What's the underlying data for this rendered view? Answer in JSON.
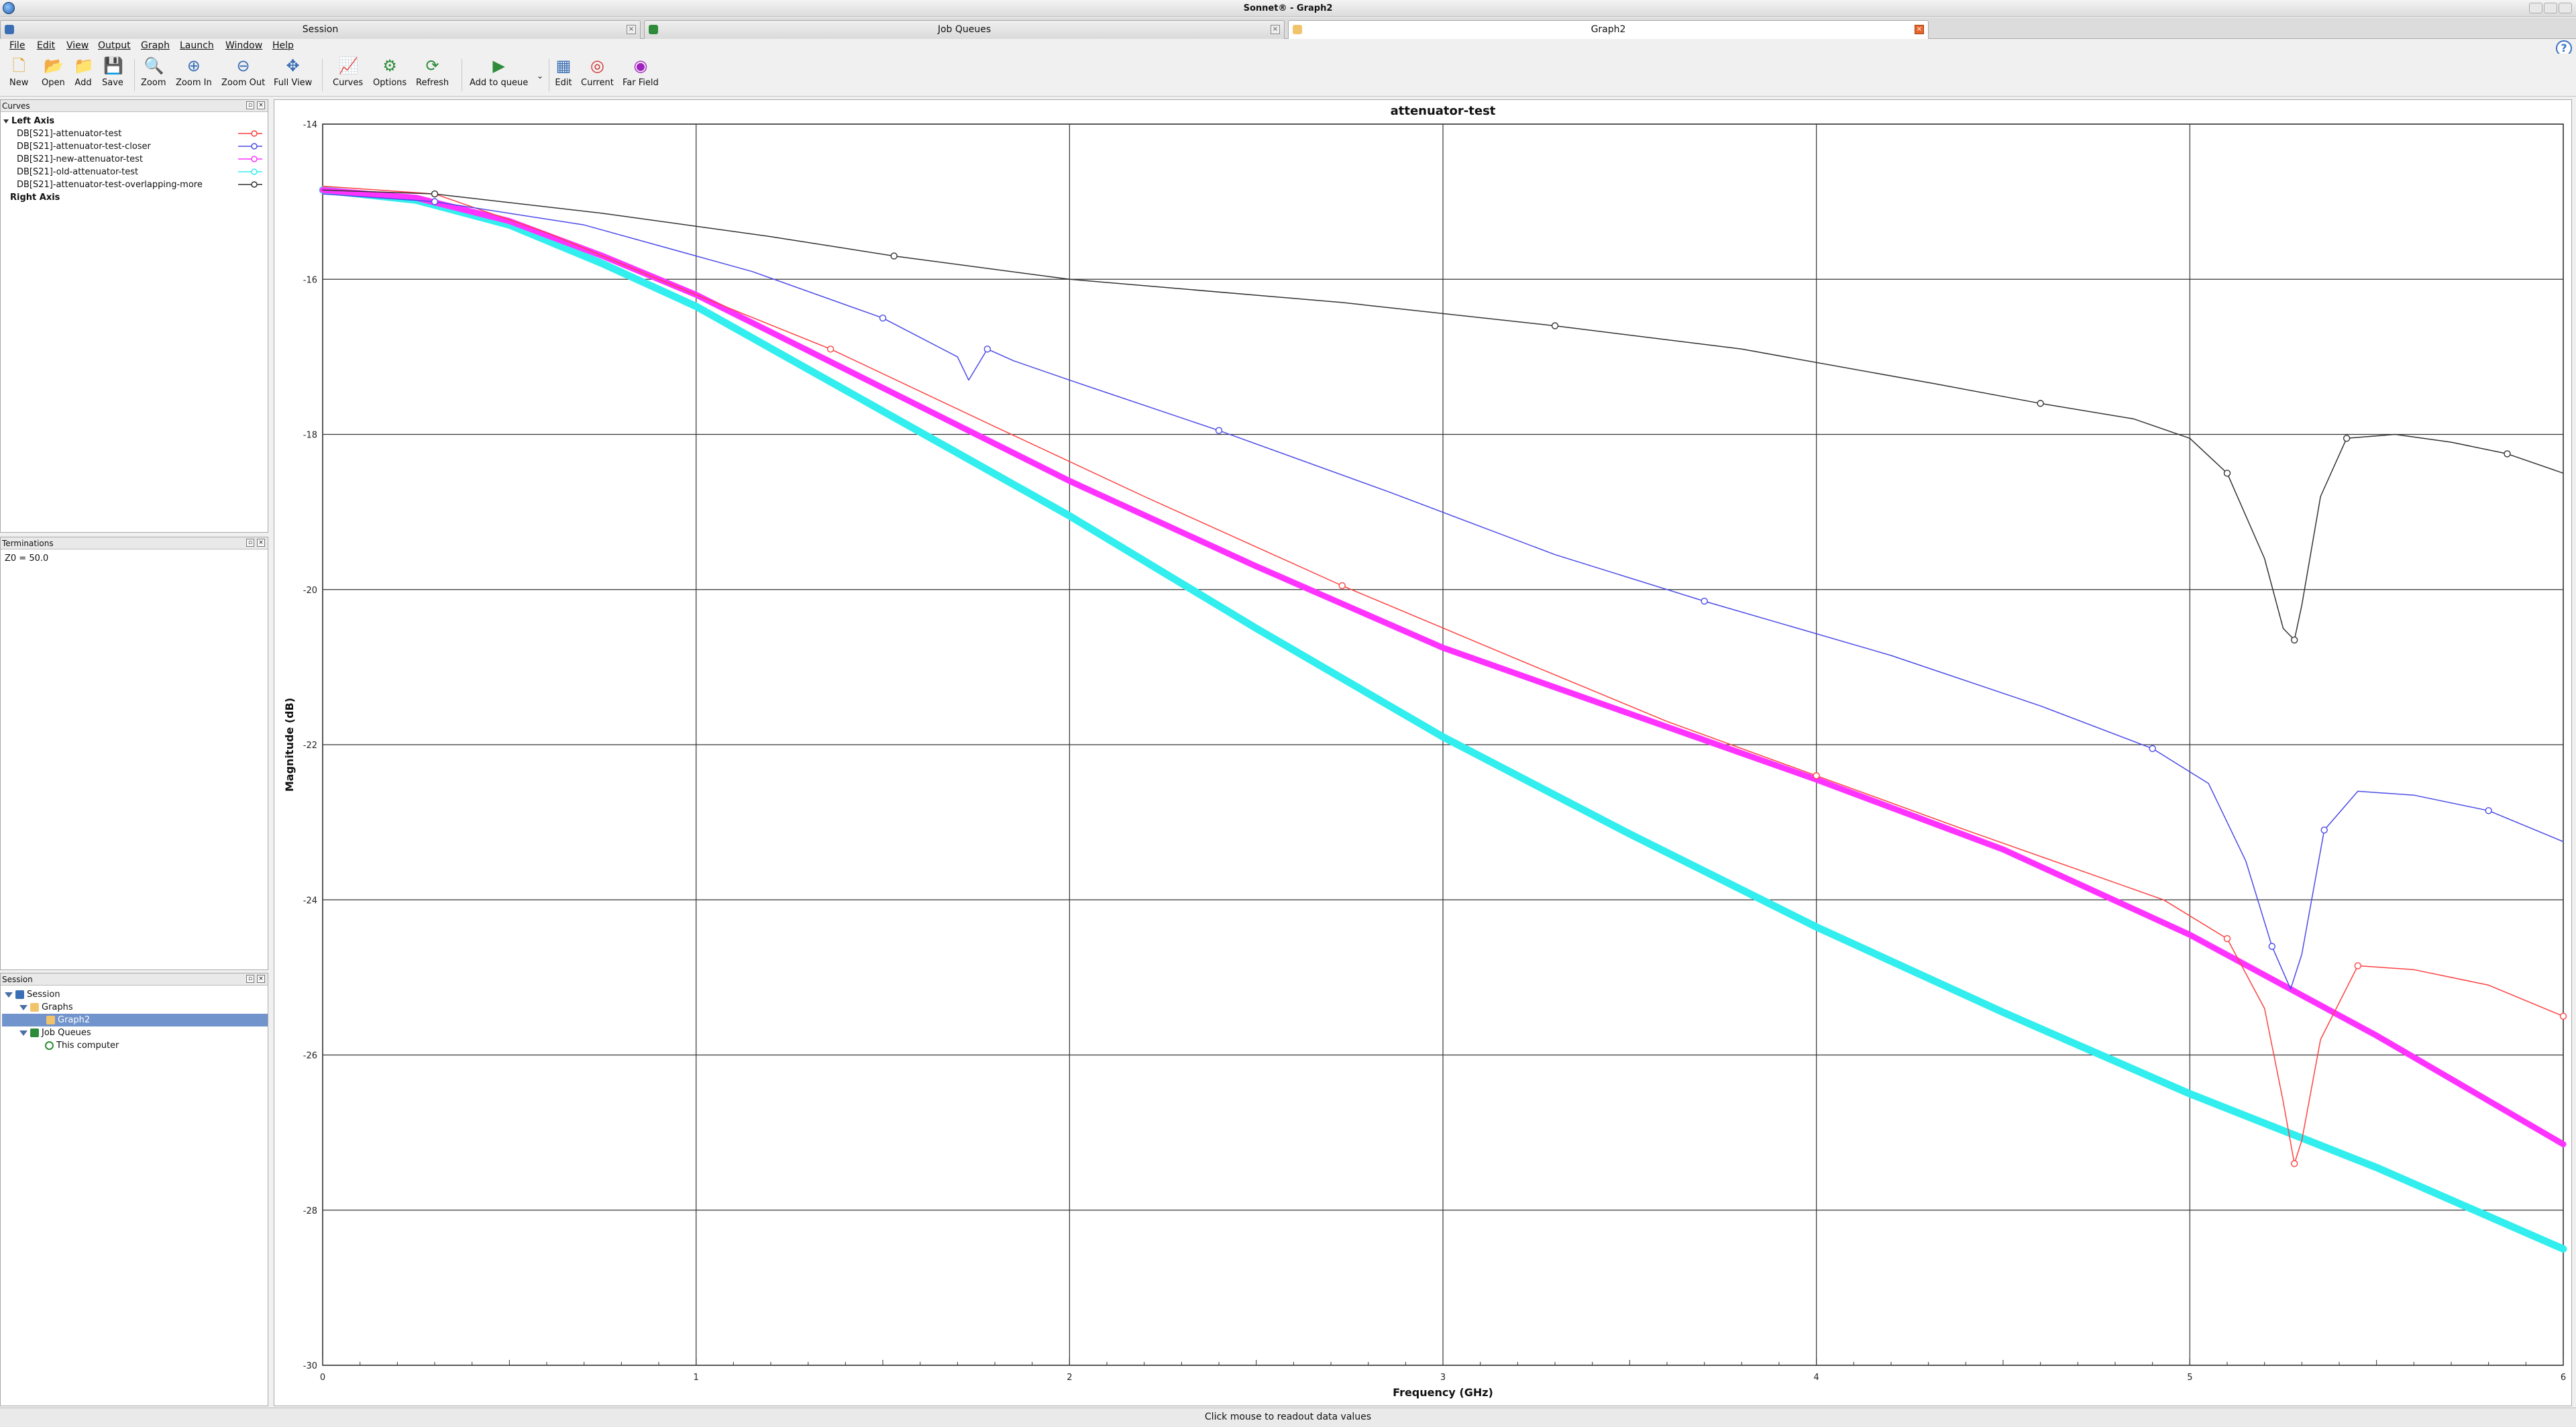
{
  "window": {
    "title": "Sonnet® - Graph2"
  },
  "tabs": [
    {
      "label": "Session"
    },
    {
      "label": "Job Queues"
    },
    {
      "label": "Graph2",
      "active": true
    }
  ],
  "menu": [
    "File",
    "Edit",
    "View",
    "Output",
    "Graph",
    "Launch",
    "Window",
    "Help"
  ],
  "toolbar": [
    {
      "label": "New",
      "icon": "new-file-icon"
    },
    {
      "label": "Open",
      "icon": "folder-open-icon"
    },
    {
      "label": "Add",
      "icon": "add-folder-icon"
    },
    {
      "label": "Save",
      "icon": "save-icon"
    },
    {
      "label": "Zoom",
      "icon": "magnifier-icon"
    },
    {
      "label": "Zoom In",
      "icon": "zoom-in-icon"
    },
    {
      "label": "Zoom Out",
      "icon": "zoom-out-icon"
    },
    {
      "label": "Full View",
      "icon": "full-view-icon"
    },
    {
      "label": "Curves",
      "icon": "curves-icon"
    },
    {
      "label": "Options",
      "icon": "gear-icon"
    },
    {
      "label": "Refresh",
      "icon": "refresh-icon"
    },
    {
      "label": "Add to queue",
      "icon": "add-to-queue-icon"
    },
    {
      "label": "Edit",
      "icon": "edit-icon"
    },
    {
      "label": "Current",
      "icon": "current-icon"
    },
    {
      "label": "Far Field",
      "icon": "far-field-icon"
    }
  ],
  "curves_panel": {
    "title": "Curves",
    "left_axis_label": "Left Axis",
    "right_axis_label": "Right Axis",
    "curves": [
      {
        "label": "DB[S21]-attenuator-test",
        "color": "#ff4040"
      },
      {
        "label": "DB[S21]-attenuator-test-closer",
        "color": "#4a4ae8"
      },
      {
        "label": "DB[S21]-new-attenuator-test",
        "color": "#ff33ff"
      },
      {
        "label": "DB[S21]-old-attenuator-test",
        "color": "#33eeee"
      },
      {
        "label": "DB[S21]-attenuator-test-overlapping-more",
        "color": "#333333"
      }
    ]
  },
  "terminations_panel": {
    "title": "Terminations",
    "text": "Z0 = 50.0"
  },
  "session_panel": {
    "title": "Session",
    "items": [
      {
        "label": "Session",
        "level": 0
      },
      {
        "label": "Graphs",
        "level": 1
      },
      {
        "label": "Graph2",
        "level": 2,
        "selected": true
      },
      {
        "label": "Job Queues",
        "level": 1
      },
      {
        "label": "This computer",
        "level": 2
      }
    ]
  },
  "status": {
    "text": "Click mouse to readout data values"
  },
  "chart_data": {
    "type": "line",
    "title": "attenuator-test",
    "xlabel": "Frequency (GHz)",
    "ylabel": "Magnitude (dB)",
    "xlim": [
      0,
      6
    ],
    "ylim": [
      -30,
      -14
    ],
    "xticks": [
      0,
      1,
      2,
      3,
      4,
      5,
      6
    ],
    "yticks": [
      -30,
      -28,
      -26,
      -24,
      -22,
      -20,
      -18,
      -16,
      -14
    ],
    "grid": true,
    "series": [
      {
        "name": "DB[S21]-attenuator-test",
        "color": "#ff4040",
        "width": 1.5,
        "x": [
          0,
          0.3,
          0.6,
          1.0,
          1.36,
          1.8,
          2.2,
          2.73,
          3.2,
          3.6,
          4.0,
          4.4,
          4.93,
          5.1,
          5.2,
          5.25,
          5.28,
          5.3,
          5.35,
          5.45,
          5.6,
          5.8,
          6.0
        ],
        "y": [
          -14.8,
          -14.9,
          -15.4,
          -16.2,
          -16.9,
          -17.9,
          -18.8,
          -19.95,
          -20.9,
          -21.7,
          -22.4,
          -23.1,
          -24.0,
          -24.5,
          -25.4,
          -26.6,
          -27.4,
          -27.1,
          -25.8,
          -24.85,
          -24.9,
          -25.1,
          -25.5
        ]
      },
      {
        "name": "DB[S21]-attenuator-test-closer",
        "color": "#4a4ae8",
        "width": 1.5,
        "x": [
          0,
          0.3,
          0.7,
          1.15,
          1.5,
          1.7,
          1.73,
          1.78,
          1.85,
          2.0,
          2.4,
          2.86,
          3.3,
          3.7,
          4.2,
          4.6,
          4.9,
          5.05,
          5.15,
          5.22,
          5.27,
          5.3,
          5.36,
          5.45,
          5.6,
          5.8,
          6.0
        ],
        "y": [
          -14.9,
          -15.0,
          -15.3,
          -15.9,
          -16.5,
          -17.0,
          -17.3,
          -16.9,
          -17.05,
          -17.3,
          -17.95,
          -18.75,
          -19.55,
          -20.15,
          -20.85,
          -21.5,
          -22.05,
          -22.5,
          -23.5,
          -24.6,
          -25.15,
          -24.7,
          -23.1,
          -22.6,
          -22.65,
          -22.85,
          -23.25
        ]
      },
      {
        "name": "DB[S21]-new-attenuator-test",
        "color": "#ff33ff",
        "width": 9,
        "x": [
          0,
          0.25,
          0.5,
          0.75,
          1.0,
          1.5,
          2.0,
          2.5,
          3.0,
          3.5,
          4.0,
          4.5,
          5.0,
          5.5,
          6.0
        ],
        "y": [
          -14.85,
          -14.95,
          -15.25,
          -15.7,
          -16.2,
          -17.4,
          -18.6,
          -19.7,
          -20.75,
          -21.6,
          -22.45,
          -23.35,
          -24.45,
          -25.75,
          -27.15
        ]
      },
      {
        "name": "DB[S21]-old-attenuator-test",
        "color": "#33eeee",
        "width": 11,
        "x": [
          0,
          0.25,
          0.5,
          0.75,
          1.0,
          1.5,
          2.0,
          2.5,
          3.0,
          3.5,
          4.0,
          4.5,
          5.0,
          5.5,
          6.0
        ],
        "y": [
          -14.85,
          -14.98,
          -15.3,
          -15.8,
          -16.35,
          -17.7,
          -19.05,
          -20.5,
          -21.9,
          -23.15,
          -24.35,
          -25.45,
          -26.5,
          -27.45,
          -28.5
        ]
      },
      {
        "name": "DB[S21]-attenuator-test-overlapping-more",
        "color": "#333333",
        "width": 1.5,
        "x": [
          0,
          0.3,
          0.75,
          1.2,
          1.53,
          2.0,
          2.73,
          3.3,
          3.8,
          4.32,
          4.6,
          4.85,
          5.0,
          5.1,
          5.2,
          5.25,
          5.28,
          5.3,
          5.35,
          5.42,
          5.55,
          5.7,
          5.85,
          6.0
        ],
        "y": [
          -14.85,
          -14.9,
          -15.15,
          -15.45,
          -15.7,
          -16.0,
          -16.3,
          -16.6,
          -16.9,
          -17.35,
          -17.6,
          -17.8,
          -18.05,
          -18.5,
          -19.6,
          -20.5,
          -20.65,
          -20.2,
          -18.8,
          -18.05,
          -18.0,
          -18.1,
          -18.25,
          -18.5
        ]
      }
    ]
  }
}
